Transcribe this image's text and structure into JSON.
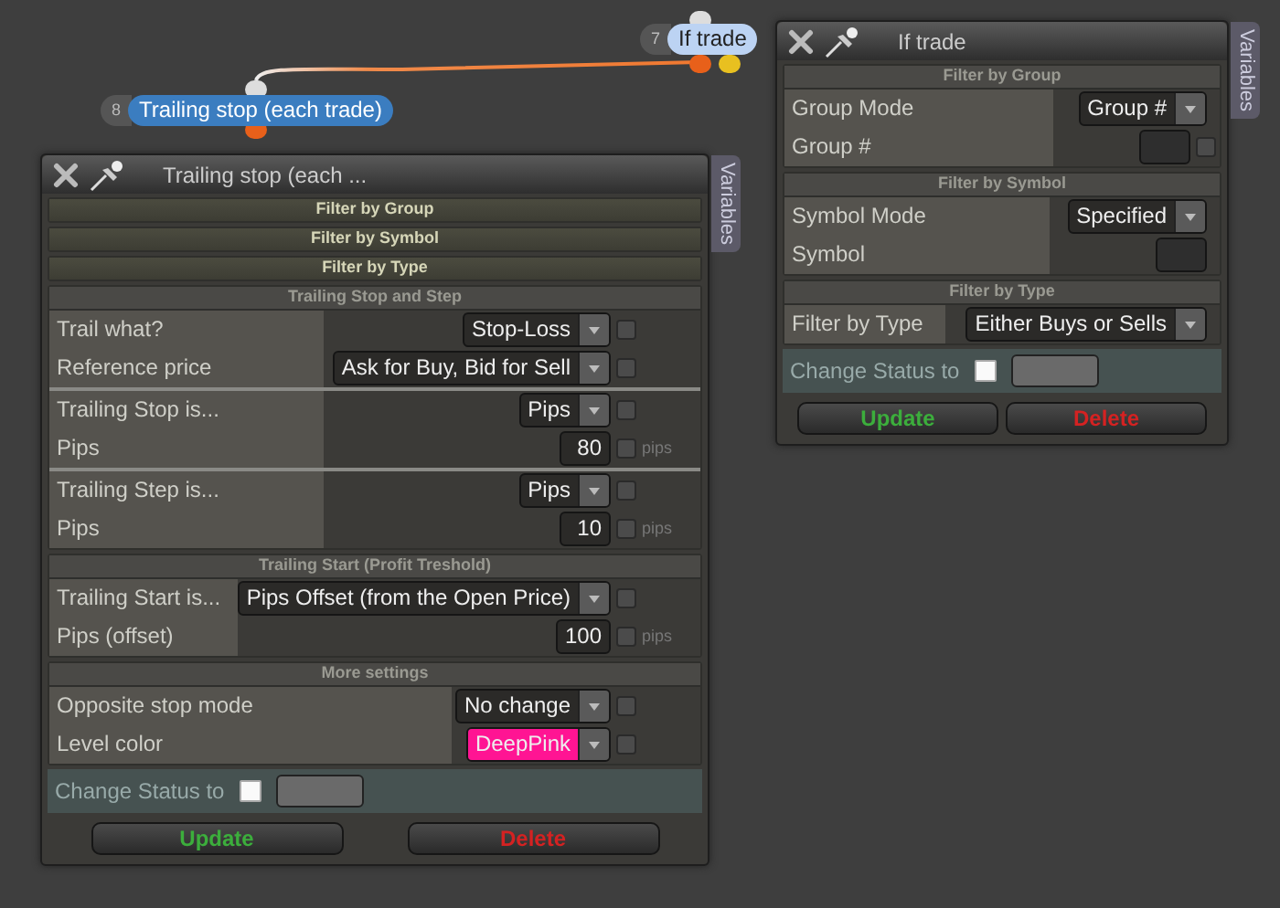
{
  "canvas": {
    "nodes": [
      {
        "number": "8",
        "label": "Trailing stop (each trade)",
        "selected": true
      },
      {
        "number": "7",
        "label": "If trade",
        "selected": false
      }
    ]
  },
  "panels": [
    {
      "title": "Trailing stop (each ...",
      "side_tab": "Variables",
      "sections": [
        {
          "heading": "Filter by Group",
          "expanded": false
        },
        {
          "heading": "Filter by Symbol",
          "expanded": false
        },
        {
          "heading": "Filter by Type",
          "expanded": false
        },
        {
          "heading": "Trailing Stop and Step",
          "expanded": true,
          "groups": [
            [
              {
                "label": "Trail what?",
                "kind": "select",
                "value": "Stop-Loss",
                "checked": false
              },
              {
                "label": "Reference price",
                "kind": "select",
                "value": "Ask for Buy, Bid for Sell",
                "checked": false
              }
            ],
            [
              {
                "label": "Trailing Stop is...",
                "kind": "select",
                "value": "Pips",
                "checked": false
              },
              {
                "label": "Pips",
                "kind": "number",
                "value": "80",
                "checked": false,
                "unit": "pips"
              }
            ],
            [
              {
                "label": "Trailing Step is...",
                "kind": "select",
                "value": "Pips",
                "checked": false
              },
              {
                "label": "Pips",
                "kind": "number",
                "value": "10",
                "checked": false,
                "unit": "pips"
              }
            ]
          ]
        },
        {
          "heading": "Trailing Start (Profit Treshold)",
          "expanded": true,
          "groups": [
            [
              {
                "label": "Trailing Start is...",
                "kind": "select",
                "value": "Pips Offset (from the Open Price)",
                "checked": false
              },
              {
                "label": "Pips (offset)",
                "kind": "number",
                "value": "100",
                "checked": false,
                "unit": "pips"
              }
            ]
          ]
        },
        {
          "heading": "More settings",
          "expanded": true,
          "groups": [
            [
              {
                "label": "Opposite stop mode",
                "kind": "select",
                "value": "No change",
                "checked": false
              },
              {
                "label": "Level color",
                "kind": "select",
                "value": "DeepPink",
                "checked": false,
                "color": "#ff1493"
              }
            ]
          ]
        }
      ],
      "status": {
        "label": "Change Status to",
        "checked": false
      },
      "buttons": [
        {
          "label": "Update",
          "kind": "update"
        },
        {
          "label": "Delete",
          "kind": "delete"
        }
      ]
    },
    {
      "title": "If trade",
      "side_tab": "Variables",
      "sections": [
        {
          "heading": "Filter by Group",
          "expanded": true,
          "groups": [
            [
              {
                "label": "Group Mode",
                "kind": "select",
                "value": "Group #"
              },
              {
                "label": "Group #",
                "kind": "field",
                "checked": false
              }
            ]
          ]
        },
        {
          "heading": "Filter by Symbol",
          "expanded": true,
          "groups": [
            [
              {
                "label": "Symbol Mode",
                "kind": "select",
                "value": "Specified"
              },
              {
                "label": "Symbol",
                "kind": "field"
              }
            ]
          ]
        },
        {
          "heading": "Filter by Type",
          "expanded": true,
          "groups": [
            [
              {
                "label": "Filter by Type",
                "kind": "select",
                "value": "Either Buys or Sells"
              }
            ]
          ]
        }
      ],
      "status": {
        "label": "Change Status to",
        "checked": false
      },
      "buttons": [
        {
          "label": "Update",
          "kind": "update"
        },
        {
          "label": "Delete",
          "kind": "delete"
        }
      ]
    }
  ]
}
